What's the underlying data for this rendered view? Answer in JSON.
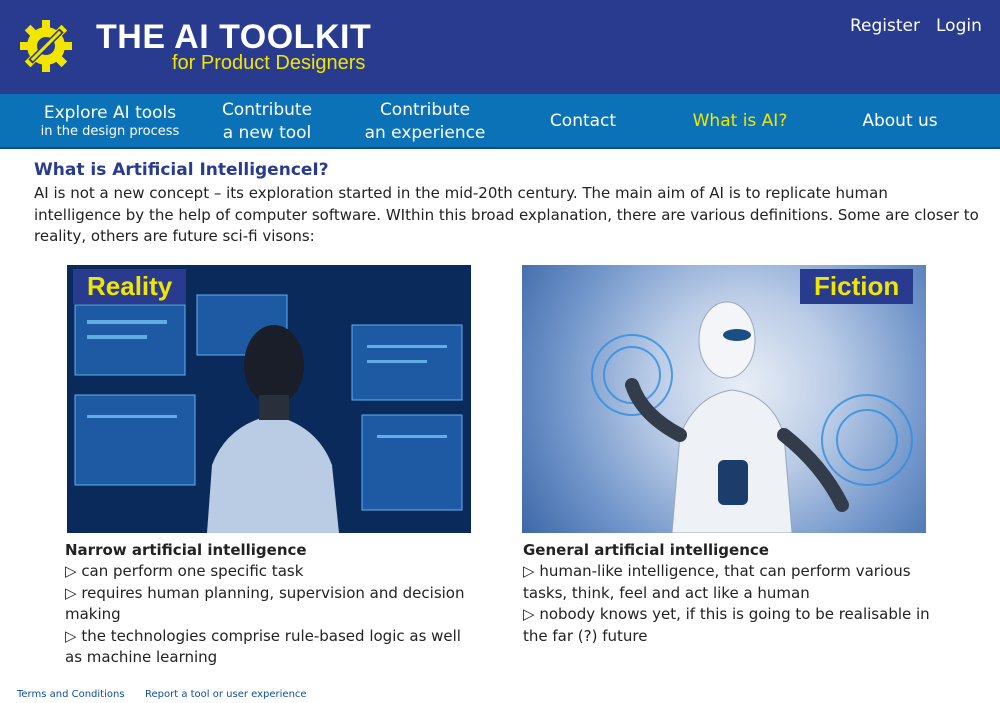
{
  "header": {
    "logo_icon": "gear-wrench-icon",
    "title": "THE AI TOOLKIT",
    "subtitle": "for Product Designers",
    "register": "Register",
    "login": "Login"
  },
  "nav": {
    "items": [
      {
        "line1": "Explore AI tools",
        "line2": "in the design process"
      },
      {
        "line1": "Contribute",
        "line2": "a new tool"
      },
      {
        "line1": "Contribute",
        "line2": "an experience"
      },
      {
        "line1": "Contact"
      },
      {
        "line1": "What is AI?"
      },
      {
        "line1": "About us"
      }
    ]
  },
  "main": {
    "title": "What is Artificial IntelligenceI?",
    "intro": "AI is not a new concept – its exploration started in the mid-20th century. The main aim of AI is to replicate human intelligence by the help of computer software. WIthin this broad explanation, there are various definitions. Some are closer to reality, others are future sci-fi visons:"
  },
  "columns": [
    {
      "image_label": "Reality",
      "title": "Narrow artificial intelligence",
      "points": [
        "can perform one specific task",
        "requires human planning, supervision and decision making",
        "the technologies comprise rule-based logic as well as machine learning"
      ]
    },
    {
      "image_label": "Fiction",
      "title": "General artificial intelligence",
      "points": [
        "human-like intelligence, that can perform various tasks, think, feel and act like a human",
        "nobody knows yet, if this is going to be realisable in the far (?) future"
      ]
    }
  ],
  "footer": {
    "terms": "Terms and Conditions",
    "report": "Report a tool or user experience"
  },
  "colors": {
    "header_bg": "#283b8f",
    "nav_bg": "#0c72b8",
    "accent_yellow": "#f2e600",
    "title_blue": "#283b8f"
  }
}
